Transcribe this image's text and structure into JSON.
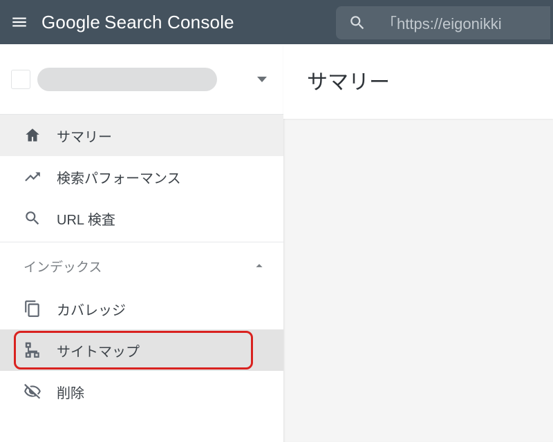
{
  "header": {
    "logo_google": "Google",
    "logo_product": "Search Console",
    "search_text": "「https://eigonikki"
  },
  "sidebar": {
    "items": {
      "0": {
        "label": "サマリー"
      },
      "1": {
        "label": "検索パフォーマンス"
      },
      "2": {
        "label": "URL 検査"
      }
    },
    "section_index": "インデックス",
    "index_items": {
      "0": {
        "label": "カバレッジ"
      },
      "1": {
        "label": "サイトマップ"
      },
      "2": {
        "label": "削除"
      }
    }
  },
  "main": {
    "title": "サマリー"
  }
}
